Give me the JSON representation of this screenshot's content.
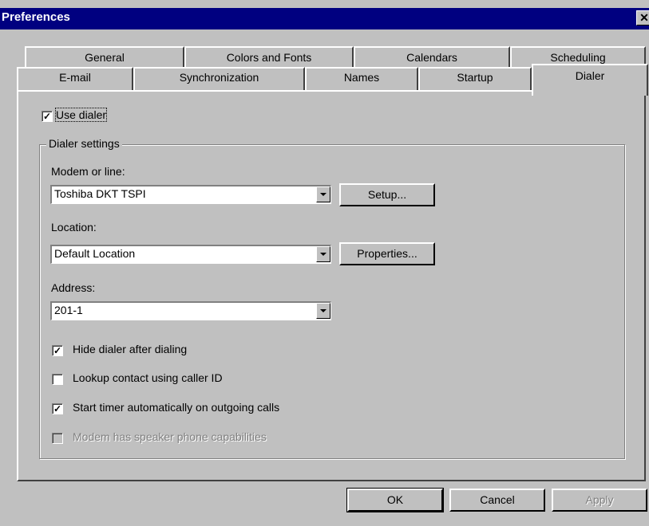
{
  "window": {
    "title": "Preferences",
    "close_glyph": "✕"
  },
  "tabs_row1": [
    "General",
    "Colors and Fonts",
    "Calendars",
    "Scheduling"
  ],
  "tabs_row2": [
    "E-mail",
    "Synchronization",
    "Names",
    "Startup",
    "Dialer"
  ],
  "active_tab": "Dialer",
  "use_dialer": {
    "label": "Use dialer",
    "checked": true
  },
  "group_title": "Dialer settings",
  "modem": {
    "label": "Modem or line:",
    "value": "Toshiba DKT TSPI",
    "button": "Setup..."
  },
  "location": {
    "label": "Location:",
    "value": "Default Location",
    "button": "Properties..."
  },
  "address": {
    "label": "Address:",
    "value": "201-1"
  },
  "options": [
    {
      "label": "Hide dialer after dialing",
      "checked": true,
      "enabled": true
    },
    {
      "label": "Lookup contact using caller ID",
      "checked": false,
      "enabled": true
    },
    {
      "label": "Start timer automatically on outgoing calls",
      "checked": true,
      "enabled": true
    },
    {
      "label": "Modem has speaker phone capabilities",
      "checked": false,
      "enabled": false
    }
  ],
  "buttons": {
    "ok": "OK",
    "cancel": "Cancel",
    "apply": "Apply"
  },
  "check_glyph": "✓"
}
